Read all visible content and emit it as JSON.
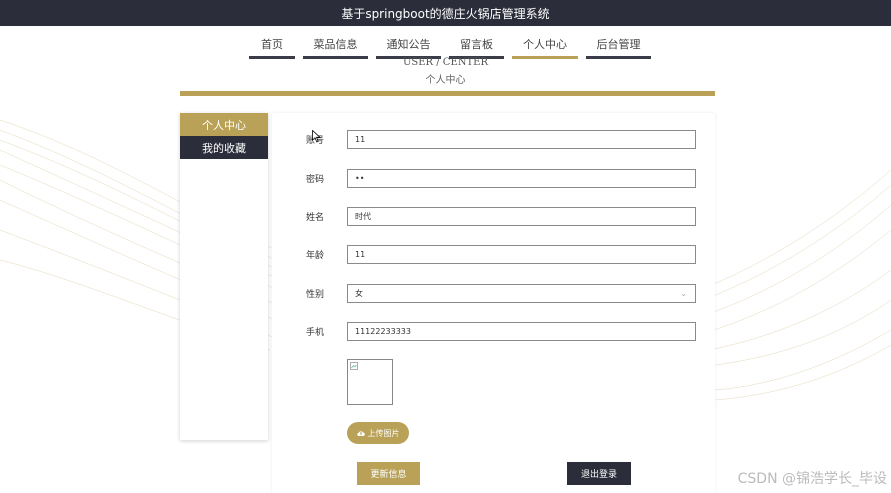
{
  "app": {
    "title": "基于springboot的德庄火锅店管理系统"
  },
  "nav": {
    "items": [
      {
        "label": "首页"
      },
      {
        "label": "菜品信息"
      },
      {
        "label": "通知公告"
      },
      {
        "label": "留言板"
      },
      {
        "label": "个人中心"
      },
      {
        "label": "后台管理"
      }
    ],
    "active": "个人中心"
  },
  "page": {
    "title_en": "USER / CENTER",
    "title_cn": "个人中心"
  },
  "sidebar": {
    "items": [
      {
        "label": "个人中心"
      },
      {
        "label": "我的收藏"
      }
    ]
  },
  "form": {
    "fields": [
      {
        "label": "账号",
        "value": "11"
      },
      {
        "label": "密码",
        "value": "••"
      },
      {
        "label": "姓名",
        "value": "时代"
      },
      {
        "label": "年龄",
        "value": "11"
      },
      {
        "label": "性别",
        "value": "女"
      },
      {
        "label": "手机",
        "value": "11122233333"
      }
    ],
    "upload_label": "上传图片",
    "update_label": "更新信息",
    "logout_label": "退出登录"
  },
  "colors": {
    "topbar": "#2b2d3a",
    "accent": "#b9a257"
  },
  "watermark": "CSDN @锦浩学长_毕设"
}
